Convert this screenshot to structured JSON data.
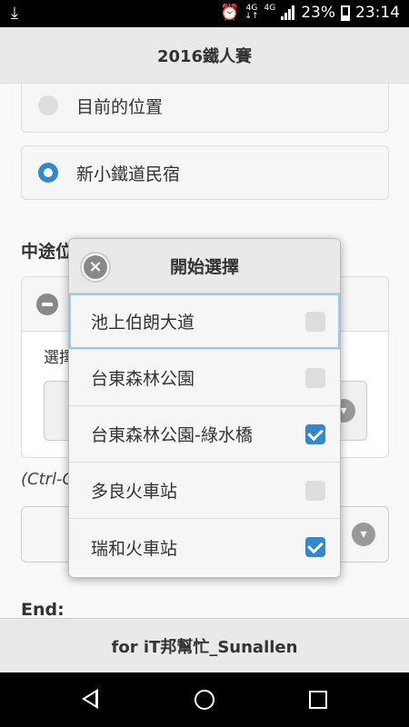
{
  "status_bar": {
    "download_icon": "download-arrow-icon",
    "alarm_icon": "alarm-clock-icon",
    "network_1": "4G",
    "network_2": "4G",
    "battery_percent": "23%",
    "time": "23:14"
  },
  "header": {
    "title": "2016鐵人賽"
  },
  "locations": {
    "items": [
      {
        "label": "目前的位置",
        "selected": false
      },
      {
        "label": "新小鐵道民宿",
        "selected": true
      }
    ]
  },
  "waypoints": {
    "label": "中途位",
    "select_label": "選擇",
    "hint": "(Ctrl-C"
  },
  "end": {
    "label": "End:"
  },
  "popup": {
    "title": "開始選擇",
    "close_icon": "close-icon",
    "options": [
      {
        "label": "池上伯朗大道",
        "checked": false
      },
      {
        "label": "台東森林公園",
        "checked": false
      },
      {
        "label": "台東森林公園-綠水橋",
        "checked": true
      },
      {
        "label": "多良火車站",
        "checked": false
      },
      {
        "label": "瑞和火車站",
        "checked": true
      }
    ]
  },
  "footer": {
    "text": "for iT邦幫忙_Sunallen"
  },
  "colors": {
    "accent": "#3388cc",
    "header_bg": "#e9e9e9",
    "status_bar_bg": "#000000"
  }
}
